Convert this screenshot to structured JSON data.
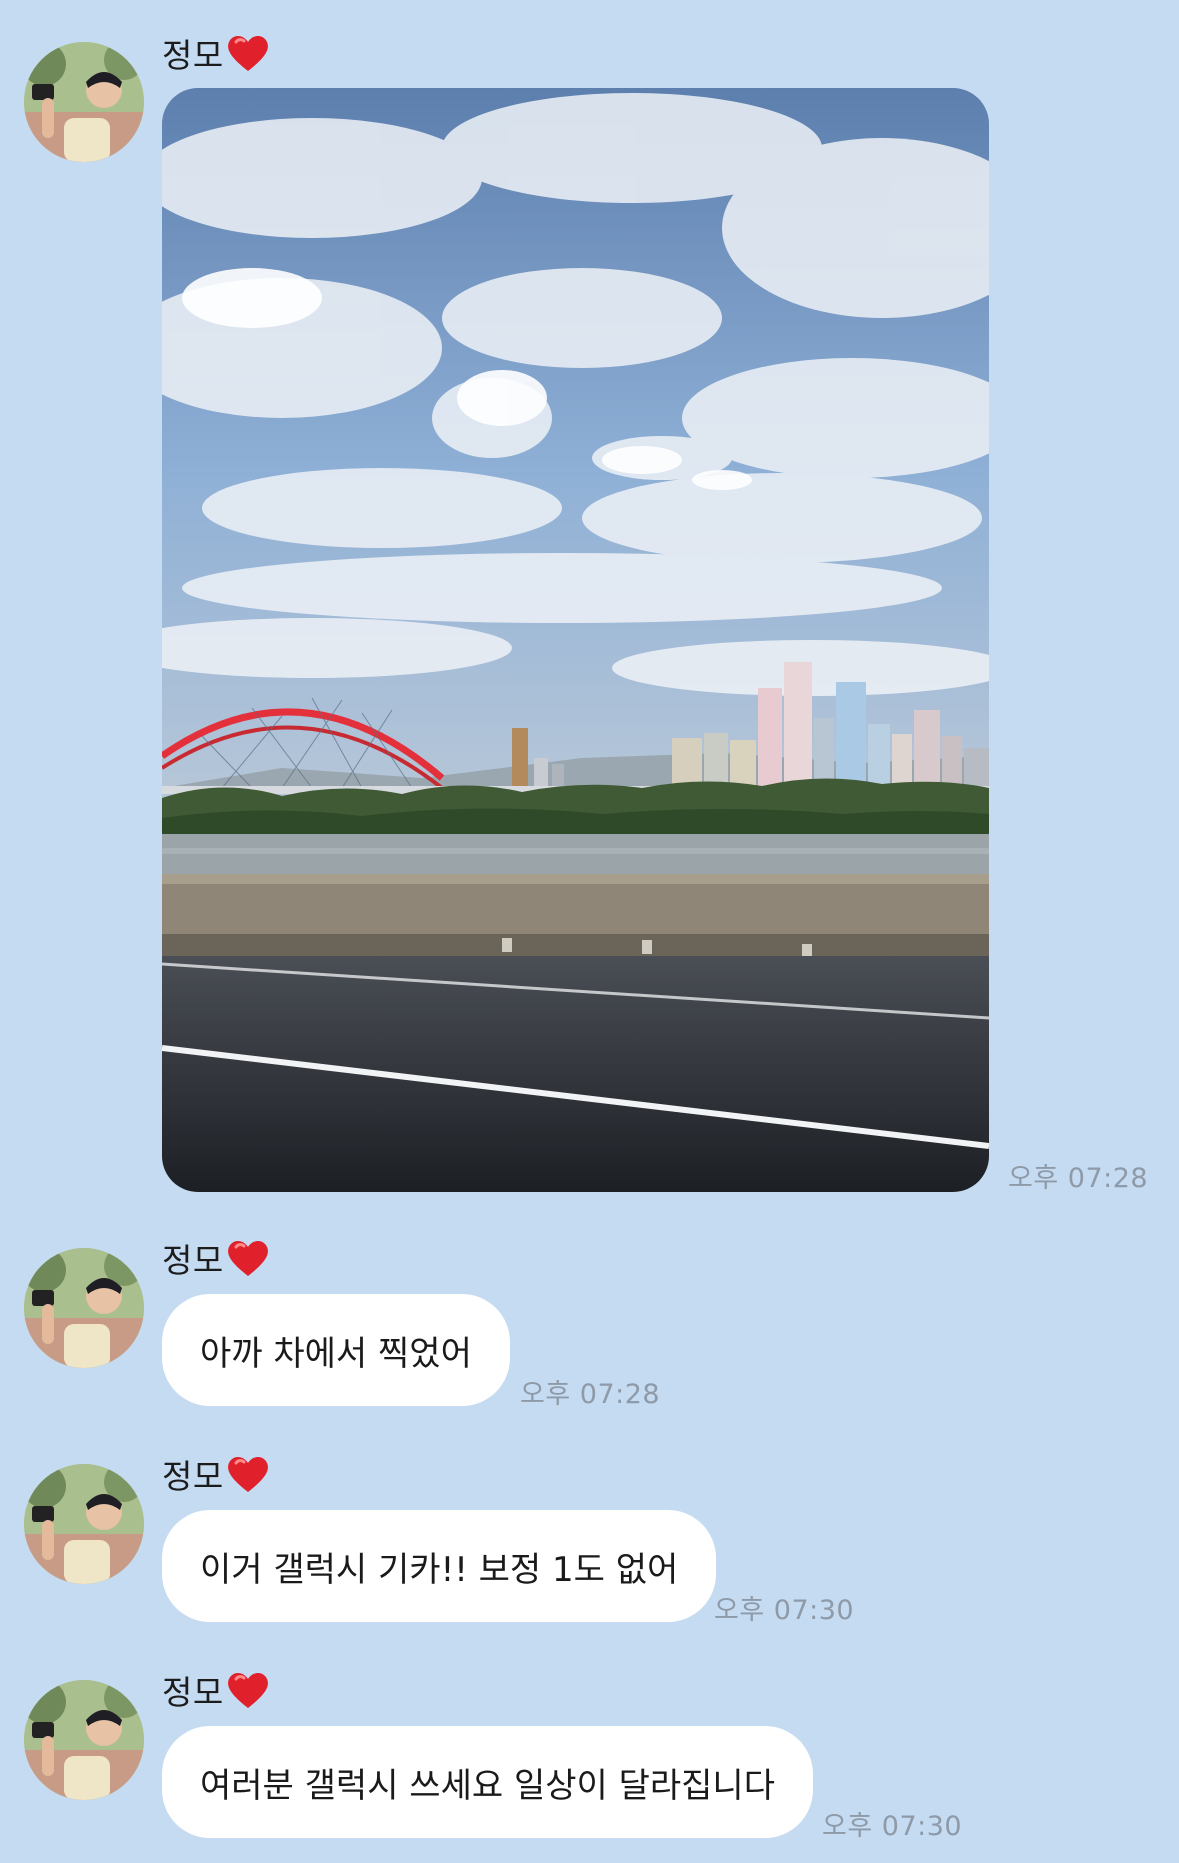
{
  "chat": {
    "messages": [
      {
        "sender": "정모",
        "type": "photo",
        "time": "오후 07:28"
      },
      {
        "sender": "정모",
        "type": "text",
        "text": "아까 차에서 찍었어",
        "time": "오후 07:28"
      },
      {
        "sender": "정모",
        "type": "text",
        "text": "이거 갤럭시 기카!! 보정 1도 없어",
        "time": "오후 07:30"
      },
      {
        "sender": "정모",
        "type": "text",
        "text": "여러분 갤럭시 쓰세요 일상이 달라집니다",
        "time": "오후 07:30"
      }
    ]
  },
  "colors": {
    "background": "#c5dbf2",
    "bubble": "#ffffff",
    "time_text": "#8e9aa8",
    "heart": "#e0202a"
  },
  "icons": {
    "heart": "red-heart-icon",
    "avatar": "profile-avatar"
  }
}
